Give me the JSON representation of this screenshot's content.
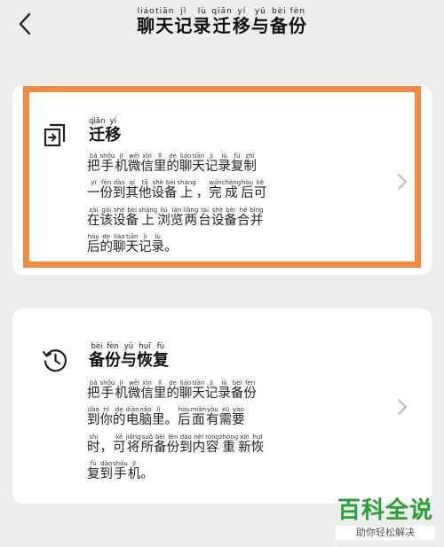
{
  "header": {
    "title": [
      {
        "h": "聊",
        "p": "liáo"
      },
      {
        "h": "天",
        "p": "tiān"
      },
      {
        "h": "记",
        "p": "jì"
      },
      {
        "h": "录",
        "p": "lù"
      },
      {
        "h": "迁",
        "p": "qiān"
      },
      {
        "h": "移",
        "p": "yí"
      },
      {
        "h": "与",
        "p": "yǔ"
      },
      {
        "h": "备",
        "p": "bèi"
      },
      {
        "h": "份",
        "p": "fèn"
      }
    ]
  },
  "cards": [
    {
      "id": "migrate",
      "icon": "migrate-icon",
      "title": [
        {
          "h": "迁",
          "p": "qiān"
        },
        {
          "h": "移",
          "p": "yí"
        }
      ],
      "desc": [
        [
          {
            "h": "把",
            "p": "bǎ"
          },
          {
            "h": "手",
            "p": "shǒu"
          },
          {
            "h": "机",
            "p": "jī"
          },
          {
            "h": "微",
            "p": "wēi"
          },
          {
            "h": "信",
            "p": "xìn"
          },
          {
            "h": "里",
            "p": "lǐ"
          },
          {
            "h": "的",
            "p": "de"
          },
          {
            "h": "聊",
            "p": "liáo"
          },
          {
            "h": "天",
            "p": "tiān"
          },
          {
            "h": "记",
            "p": "jì"
          },
          {
            "h": "录",
            "p": "lù"
          },
          {
            "h": "复",
            "p": "fù"
          },
          {
            "h": "制",
            "p": "zhì"
          }
        ],
        [
          {
            "h": "一",
            "p": "yī"
          },
          {
            "h": "份",
            "p": "fèn"
          },
          {
            "h": "到",
            "p": "dào"
          },
          {
            "h": "其",
            "p": "qí"
          },
          {
            "h": "他",
            "p": "tā"
          },
          {
            "h": "设",
            "p": "shè"
          },
          {
            "h": "备",
            "p": "bèi"
          },
          {
            "h": "上",
            "p": "shàng"
          },
          {
            "h": "，",
            "p": ""
          },
          {
            "h": "完",
            "p": "wán"
          },
          {
            "h": "成",
            "p": "chéng"
          },
          {
            "h": "后",
            "p": "hòu"
          },
          {
            "h": "可",
            "p": "kě"
          }
        ],
        [
          {
            "h": "在",
            "p": "zài"
          },
          {
            "h": "该",
            "p": "gāi"
          },
          {
            "h": "设",
            "p": "shè"
          },
          {
            "h": "备",
            "p": "bèi"
          },
          {
            "h": "上",
            "p": "shàng"
          },
          {
            "h": "浏",
            "p": "liú"
          },
          {
            "h": "览",
            "p": "lǎn"
          },
          {
            "h": "两",
            "p": "liǎng"
          },
          {
            "h": "台",
            "p": "tái"
          },
          {
            "h": "设",
            "p": "shè"
          },
          {
            "h": "备",
            "p": "bèi"
          },
          {
            "h": "合",
            "p": "hé"
          },
          {
            "h": "并",
            "p": "bìng"
          }
        ],
        [
          {
            "h": "后",
            "p": "hòu"
          },
          {
            "h": "的",
            "p": "de"
          },
          {
            "h": "聊",
            "p": "liáo"
          },
          {
            "h": "天",
            "p": "tiān"
          },
          {
            "h": "记",
            "p": "jì"
          },
          {
            "h": "录",
            "p": "lù"
          },
          {
            "h": "。",
            "p": ""
          }
        ]
      ]
    },
    {
      "id": "backup",
      "icon": "history-clock-icon",
      "title": [
        {
          "h": "备",
          "p": "bèi"
        },
        {
          "h": "份",
          "p": "fèn"
        },
        {
          "h": "与",
          "p": "yǔ"
        },
        {
          "h": "恢",
          "p": "huī"
        },
        {
          "h": "复",
          "p": "fù"
        }
      ],
      "desc": [
        [
          {
            "h": "把",
            "p": "bǎ"
          },
          {
            "h": "手",
            "p": "shǒu"
          },
          {
            "h": "机",
            "p": "jī"
          },
          {
            "h": "微",
            "p": "wēi"
          },
          {
            "h": "信",
            "p": "xìn"
          },
          {
            "h": "里",
            "p": "lǐ"
          },
          {
            "h": "的",
            "p": "de"
          },
          {
            "h": "聊",
            "p": "liáo"
          },
          {
            "h": "天",
            "p": "tiān"
          },
          {
            "h": "记",
            "p": "jì"
          },
          {
            "h": "录",
            "p": "lù"
          },
          {
            "h": "备",
            "p": "bèi"
          },
          {
            "h": "份",
            "p": "fèn"
          }
        ],
        [
          {
            "h": "到",
            "p": "dào"
          },
          {
            "h": "你",
            "p": "nǐ"
          },
          {
            "h": "的",
            "p": "de"
          },
          {
            "h": "电",
            "p": "diàn"
          },
          {
            "h": "脑",
            "p": "nǎo"
          },
          {
            "h": "里",
            "p": "lǐ"
          },
          {
            "h": "。",
            "p": ""
          },
          {
            "h": "后",
            "p": "hòu"
          },
          {
            "h": "面",
            "p": "miàn"
          },
          {
            "h": "有",
            "p": "yǒu"
          },
          {
            "h": "需",
            "p": "xū"
          },
          {
            "h": "要",
            "p": "yào"
          }
        ],
        [
          {
            "h": "时",
            "p": "shí"
          },
          {
            "h": "，",
            "p": ""
          },
          {
            "h": "可",
            "p": "kě"
          },
          {
            "h": "将",
            "p": "jiāng"
          },
          {
            "h": "所",
            "p": "suǒ"
          },
          {
            "h": "备",
            "p": "bèi"
          },
          {
            "h": "份",
            "p": "fèn"
          },
          {
            "h": "到",
            "p": "dào"
          },
          {
            "h": "内",
            "p": "nèi"
          },
          {
            "h": "容",
            "p": "róng"
          },
          {
            "h": "重",
            "p": "zhòng"
          },
          {
            "h": "新",
            "p": "xīn"
          },
          {
            "h": "恢",
            "p": "huī"
          }
        ],
        [
          {
            "h": "复",
            "p": "fù"
          },
          {
            "h": "到",
            "p": "dào"
          },
          {
            "h": "手",
            "p": "shǒu"
          },
          {
            "h": "机",
            "p": "jī"
          },
          {
            "h": "。",
            "p": ""
          }
        ]
      ]
    }
  ],
  "highlight_color": "#ef8a3e",
  "watermark": {
    "title": "百科全说",
    "subtitle": "助你轻松解决",
    "color": "#2aa136"
  }
}
